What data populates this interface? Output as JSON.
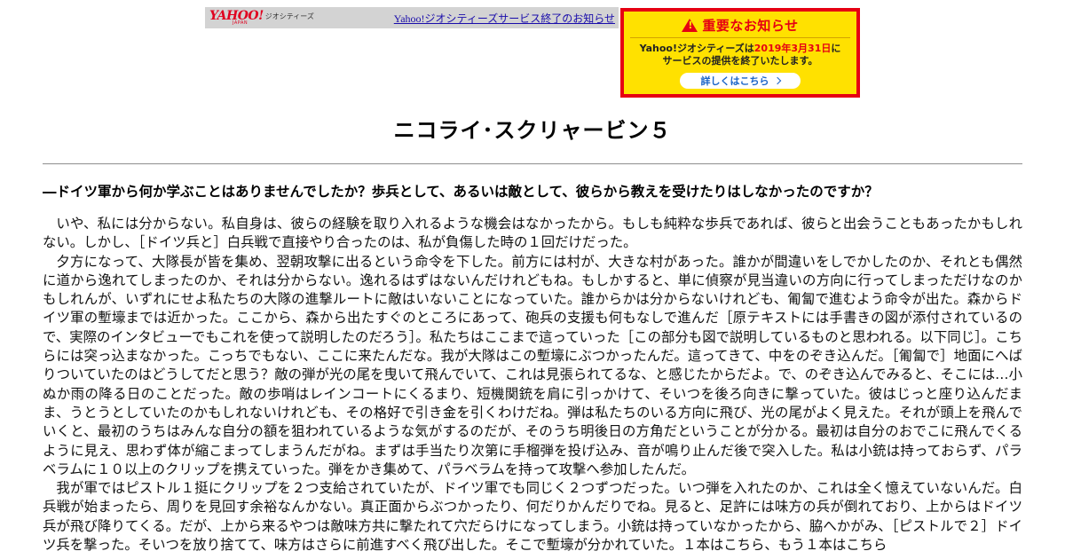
{
  "banner": {
    "logo_text": "YAHOO!",
    "logo_sub": "JAPAN",
    "service_name": "ジオシティーズ",
    "link_text": "Yahoo!ジオシティーズサービス終了のお知らせ"
  },
  "notice": {
    "title": "重要なお知らせ",
    "line1_pre": "Yahoo!ジオシティーズは",
    "line1_date": "2019年3月31日",
    "line1_post": "に",
    "line2": "サービスの提供を終了いたします。",
    "button_label": "詳しくはこちら",
    "colors": {
      "border": "#e60012",
      "background": "#ffe100",
      "button_text": "#1a64c8"
    }
  },
  "article": {
    "title": "ニコライ･スクリャービン５",
    "question": "―ドイツ軍から何か学ぶことはありませんでしたか？歩兵として、あるいは敵として、彼らから教えを受けたりはしなかったのですか？",
    "paragraphs": [
      "いや、私には分からない。私自身は、彼らの経験を取り入れるような機会はなかったから。もしも純粋な歩兵であれば、彼らと出会うこともあったかもしれない。しかし、［ドイツ兵と］白兵戦で直接やり合ったのは、私が負傷した時の１回だけだった。",
      "夕方になって、大隊長が皆を集め、翌朝攻撃に出るという命令を下した。前方には村が、大きな村があった。誰かが間違いをしでかしたのか、それとも偶然に道から逸れてしまったのか、それは分からない。逸れるはずはないんだけれどもね。もしかすると、単に偵察が見当違いの方向に行ってしまっただけなのかもしれんが、いずれにせよ私たちの大隊の進撃ルートに敵はいないことになっていた。誰からかは分からないけれども、匍匐で進むよう命令が出た。森からドイツ軍の塹壕までは近かった。ここから、森から出たすぐのところにあって、砲兵の支援も何もなしで進んだ［原テキストには手書きの図が添付されているので、実際のインタビューでもこれを使って説明したのだろう］。私たちはここまで這っていった［この部分も図で説明しているものと思われる。以下同じ］。こちらには突っ込まなかった。こっちでもない、ここに来たんだな。我が大隊はこの塹壕にぶつかったんだ。這ってきて、中をのぞき込んだ。［匍匐で］地面にへばりついていたのはどうしてだと思う？敵の弾が光の尾を曳いて飛んでいて、これは見張られてるな、と感じたからだよ。で、のぞき込んでみると、そこには…小ぬか雨の降る日のことだった。敵の歩哨はレインコートにくるまり、短機関銃を肩に引っかけて、そいつを後ろ向きに撃っていた。彼はじっと座り込んだまま、うとうとしていたのかもしれないけれども、その格好で引き金を引くわけだね。弾は私たちのいる方向に飛び、光の尾がよく見えた。それが頭上を飛んでいくと、最初のうちはみんな自分の額を狙われているような気がするのだが、そのうち明後日の方角だということが分かる。最初は自分のおでこに飛んでくるように見え、思わず体が縮こまってしまうんだがね。まずは手当たり次第に手榴弾を投げ込み、音が鳴り止んだ後で突入した。私は小銃は持っておらず、パラベラムに１０以上のクリップを携えていった。弾をかき集めて、パラベラムを持って攻撃へ参加したんだ。",
      "我が軍ではピストル１挺にクリップを２つ支給されていたが、ドイツ軍でも同じく２つずつだった。いつ弾を入れたのか、これは全く憶えていないんだ。白兵戦が始まったら、周りを見回す余裕なんかない。真正面からぶつかったり、何だりかんだりでね。見ると、足許には味方の兵が倒れており、上からはドイツ兵が飛び降りてくる。だが、上から来るやつは敵味方共に撃たれて穴だらけになってしまう。小銃は持っていなかったから、脇へかがみ、［ピストルで２］ドイツ兵を撃った。そいつを放り捨てて、味方はさらに前進すべく飛び出した。そこで塹壕が分かれていた。１本はこちら、もう１本はこちら"
    ]
  }
}
